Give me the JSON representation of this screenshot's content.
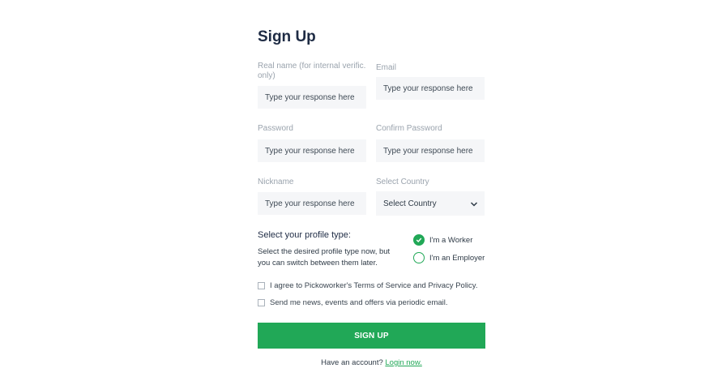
{
  "title": "Sign Up",
  "fields": {
    "real_name": {
      "label": "Real name (for internal verific. only)",
      "placeholder": "Type your response here"
    },
    "email": {
      "label": "Email",
      "placeholder": "Type your response here"
    },
    "password": {
      "label": "Password",
      "placeholder": "Type your response here"
    },
    "confirm_password": {
      "label": "Confirm Password",
      "placeholder": "Type your response here"
    },
    "nickname": {
      "label": "Nickname",
      "placeholder": "Type your response here"
    },
    "country": {
      "label": "Select Country",
      "value": "Select Country",
      "icon": "chevron-down-icon"
    }
  },
  "profile_type": {
    "title": "Select your profile type:",
    "description": "Select the desired profile type now, but you can switch between them later.",
    "options": [
      {
        "label": "I'm a Worker",
        "selected": true
      },
      {
        "label": "I'm an Employer",
        "selected": false
      }
    ]
  },
  "checkboxes": {
    "terms": "I agree to Pickoworker's Terms of Service and Privacy Policy.",
    "news": "Send me news, events and offers via periodic email."
  },
  "submit_label": "SIGN UP",
  "footer": {
    "text": "Have an account?",
    "link": "Login now."
  },
  "colors": {
    "accent": "#21a857",
    "title": "#1e2b44",
    "field_bg": "#f5f6f8",
    "label": "#9aa3ad"
  }
}
